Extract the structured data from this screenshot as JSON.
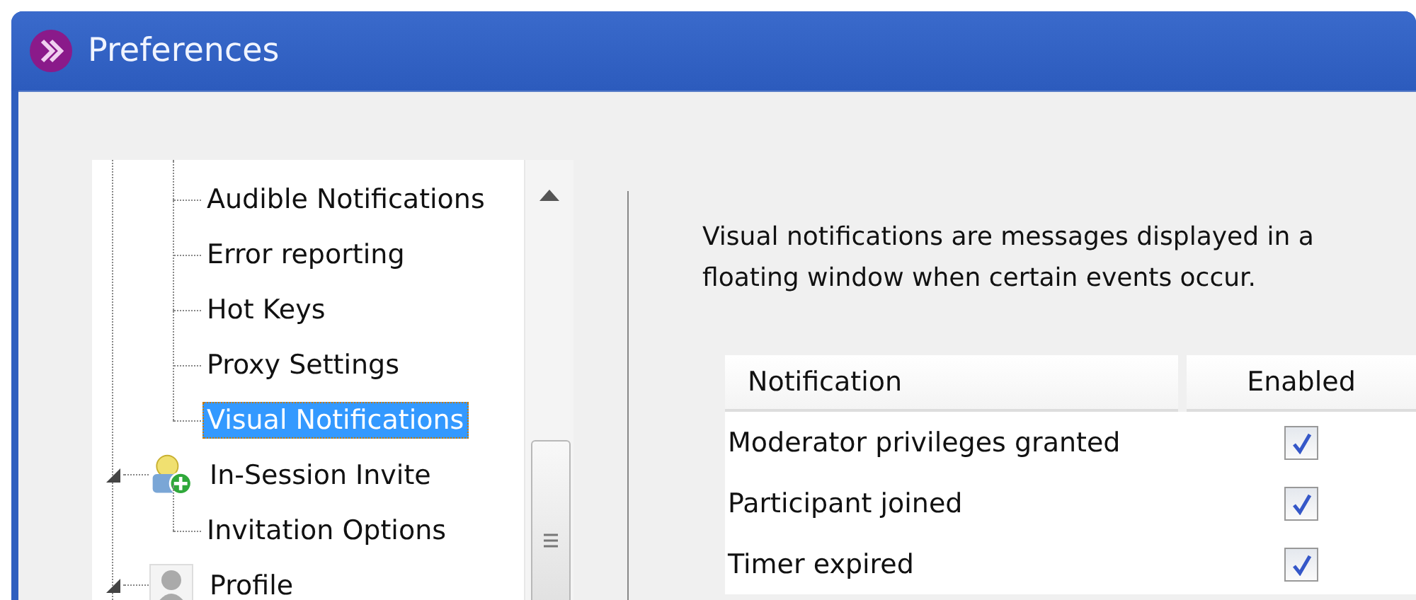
{
  "window": {
    "title": "Preferences"
  },
  "tree": {
    "items": [
      {
        "children": [
          {
            "label": "Audible Notifications",
            "selected": false
          },
          {
            "label": "Error reporting",
            "selected": false
          },
          {
            "label": "Hot Keys",
            "selected": false
          },
          {
            "label": "Proxy Settings",
            "selected": false
          },
          {
            "label": "Visual Notifications",
            "selected": true
          }
        ]
      },
      {
        "label": "In-Session Invite",
        "selected": false,
        "expanded": true,
        "kind": "invite",
        "children": [
          {
            "label": "Invitation Options",
            "selected": false
          }
        ]
      },
      {
        "label": "Profile",
        "selected": false,
        "expanded": true,
        "kind": "profile"
      }
    ]
  },
  "panel": {
    "description": "Visual notifications are messages displayed in a floating window when certain events occur.",
    "table": {
      "columns": [
        "Notification",
        "Enabled"
      ],
      "rows": [
        {
          "name": "Moderator privileges granted",
          "checked": true
        },
        {
          "name": "Participant joined",
          "checked": true
        },
        {
          "name": "Timer expired",
          "checked": true
        }
      ]
    }
  }
}
